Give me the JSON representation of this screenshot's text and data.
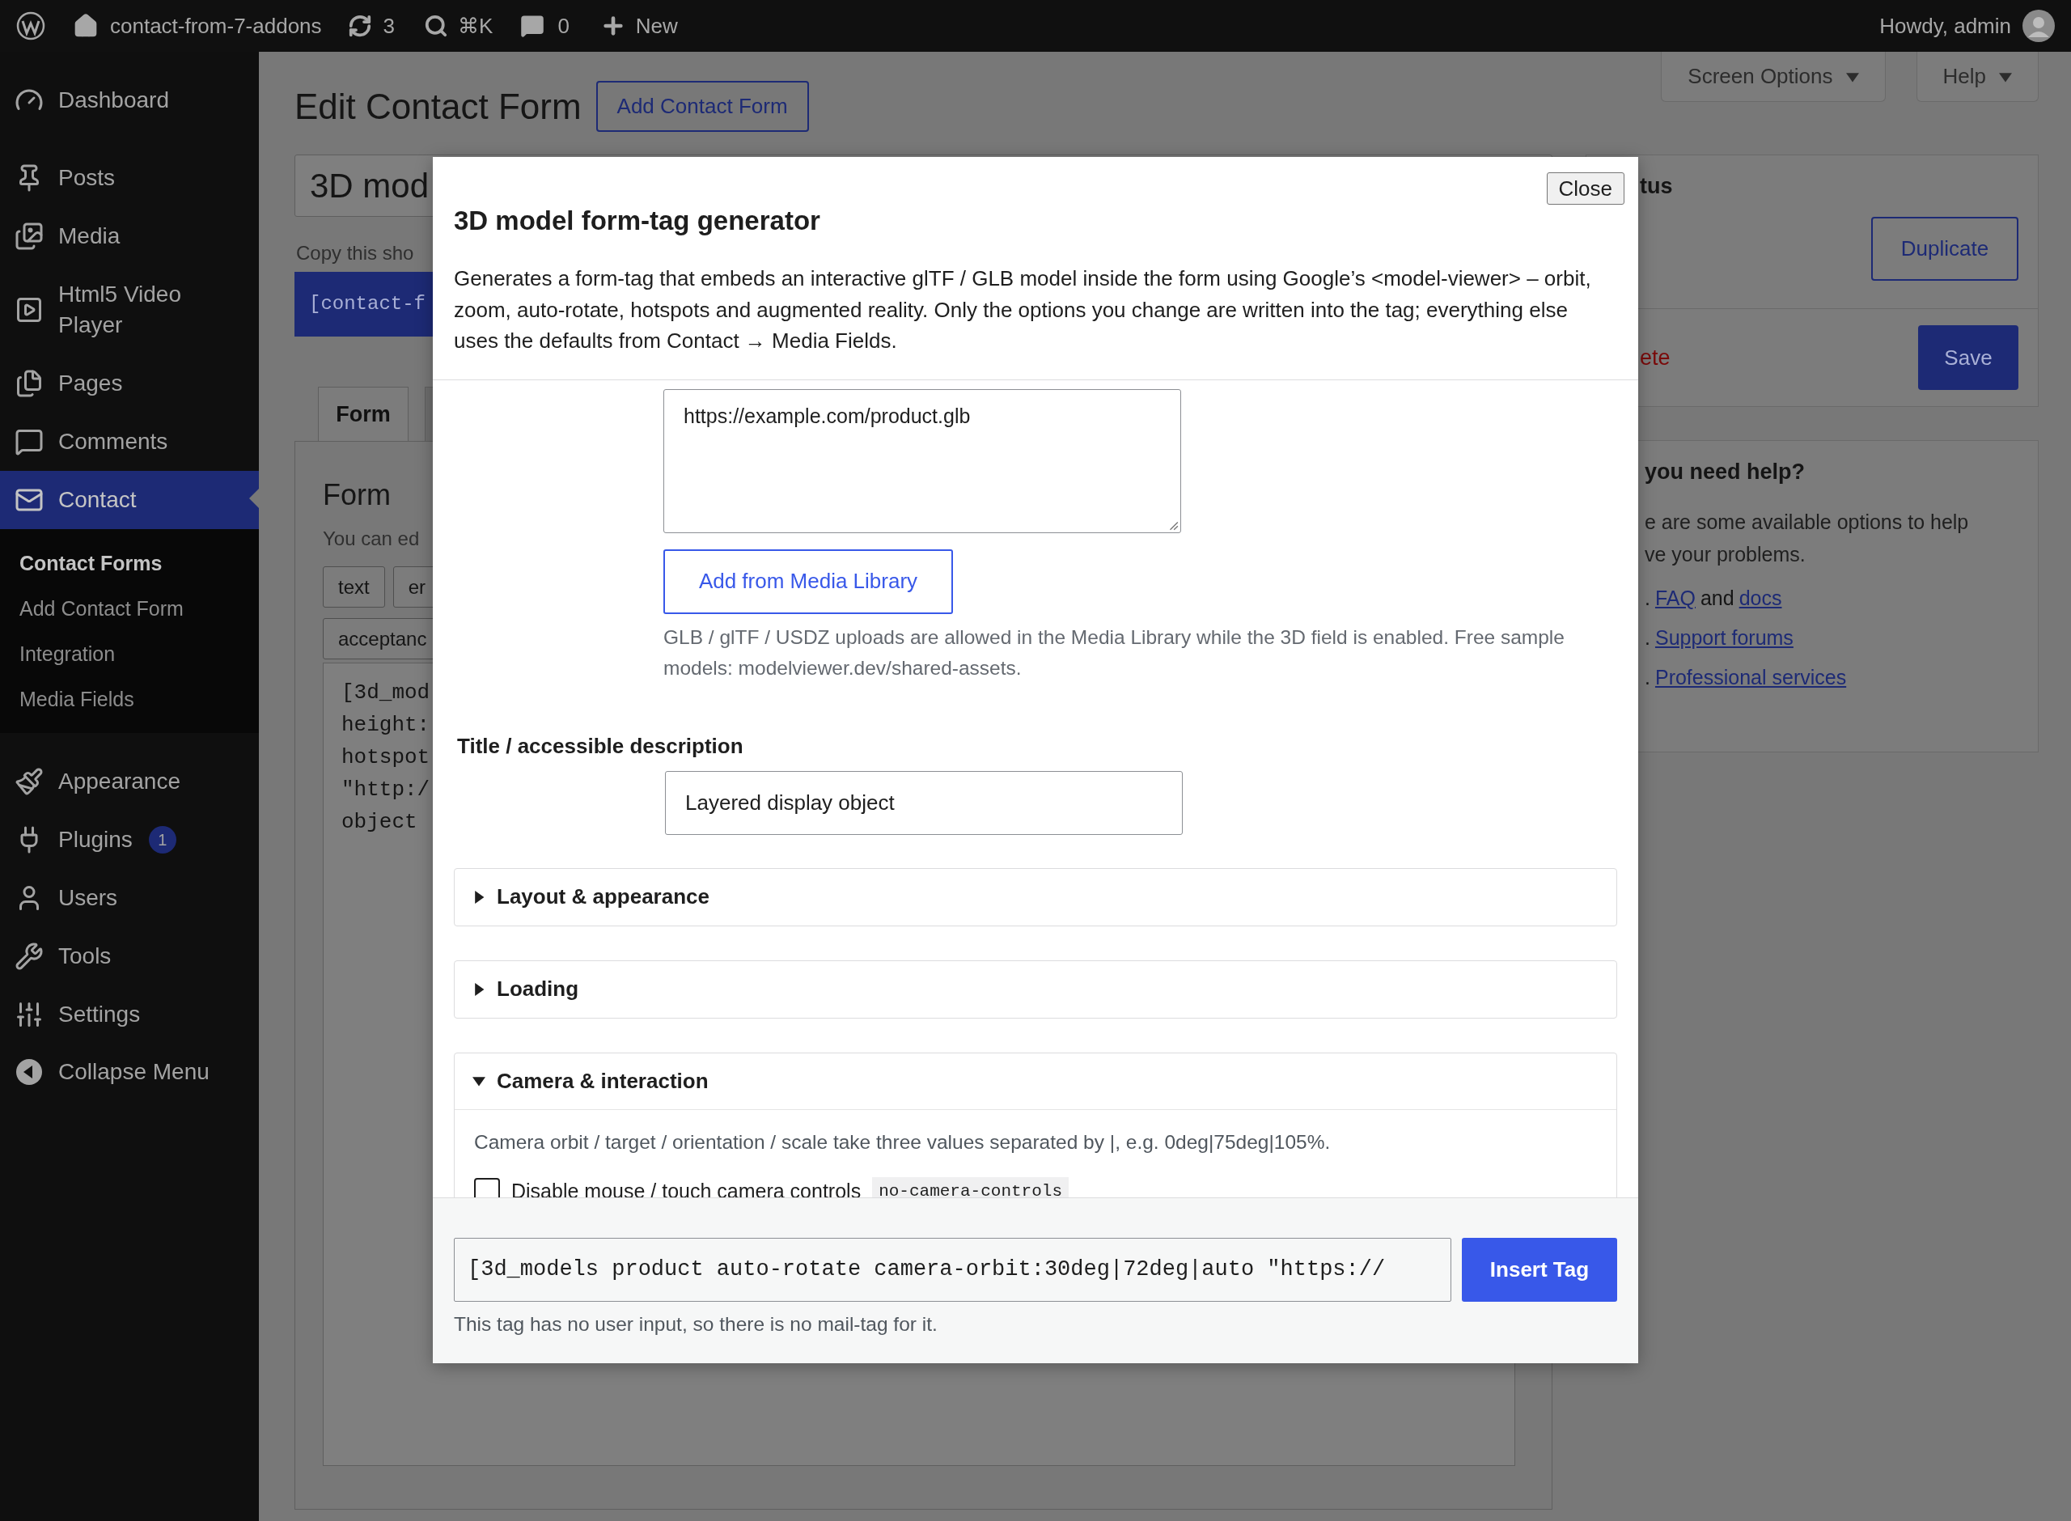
{
  "admin_bar": {
    "site": "contact-from-7-addons",
    "updates": "3",
    "search_shortcut": "⌘K",
    "comments": "0",
    "new": "New",
    "greeting": "Howdy, admin"
  },
  "sidebar": {
    "items": [
      {
        "label": "Dashboard",
        "selected": false
      },
      {
        "label": "Posts",
        "selected": false
      },
      {
        "label": "Media",
        "selected": false
      },
      {
        "label": "Html5 Video Player",
        "selected": false
      },
      {
        "label": "Pages",
        "selected": false
      },
      {
        "label": "Comments",
        "selected": false
      },
      {
        "label": "Contact",
        "selected": true,
        "children": [
          {
            "label": "Contact Forms",
            "selected": true
          },
          {
            "label": "Add Contact Form",
            "selected": false
          },
          {
            "label": "Integration",
            "selected": false
          },
          {
            "label": "Media Fields",
            "selected": false
          }
        ]
      },
      {
        "label": "Appearance",
        "selected": false
      },
      {
        "label": "Plugins",
        "selected": false,
        "badge": "1"
      },
      {
        "label": "Users",
        "selected": false
      },
      {
        "label": "Tools",
        "selected": false
      },
      {
        "label": "Settings",
        "selected": false
      }
    ],
    "collapse": "Collapse Menu"
  },
  "screen_meta": [
    "Screen Options",
    "Help"
  ],
  "page": {
    "title": "Edit Contact Form",
    "add_button": "Add Contact Form",
    "form_title": "3D mod",
    "shortcode_hint": "Copy this sho",
    "shortcode": "[contact-f",
    "tabs": [
      {
        "label": "Form",
        "selected": true
      }
    ],
    "form_panel": {
      "heading": "Form",
      "hint": "You can ed",
      "tag_button_rows": [
        [
          "text",
          "er"
        ],
        [
          "acceptanc"
        ]
      ],
      "code_lines": [
        "[3d_mod",
        "height:",
        "hotspot",
        "\"http:/",
        "object"
      ]
    }
  },
  "status_box": {
    "heading": "tus",
    "duplicate": "Duplicate",
    "delete": "ete",
    "save": "Save"
  },
  "help_box": {
    "heading": "you need help?",
    "text_lines": [
      "e are some available options to help",
      "ve your problems."
    ],
    "items": [
      {
        "marker": ".",
        "segments": [
          {
            "kind": "link",
            "text": "FAQ"
          },
          {
            "kind": "text",
            "text": "and"
          },
          {
            "kind": "link",
            "text": "docs"
          }
        ]
      },
      {
        "marker": ".",
        "segments": [
          {
            "kind": "link",
            "text": "Support forums"
          }
        ]
      },
      {
        "marker": ".",
        "segments": [
          {
            "kind": "link",
            "text": "Professional services"
          }
        ]
      }
    ]
  },
  "modal": {
    "close": "Close",
    "title": "3D model form-tag generator",
    "description": "Generates a form-tag that embeds an interactive glTF / GLB model inside the form using Google’s <model-viewer> – orbit, zoom, auto-rotate, hotspots and augmented reality. Only the options you change are written into the tag; everything else uses the defaults from Contact → Media Fields.",
    "source_value": "https://example.com/product.glb",
    "media_button": "Add from Media Library",
    "source_hint": "GLB / glTF / USDZ uploads are allowed in the Media Library while the 3D field is enabled. Free sample models: modelviewer.dev/shared-assets.",
    "title_label": "Title / accessible description",
    "title_value": "Layered display object",
    "sections": [
      {
        "title": "Layout & appearance",
        "expanded": false
      },
      {
        "title": "Loading",
        "expanded": false
      },
      {
        "title": "Camera & interaction",
        "expanded": true,
        "hint": "Camera orbit / target / orientation / scale take three values separated by |, e.g. 0deg|75deg|105%.",
        "options": [
          {
            "label": "Disable mouse / touch camera controls",
            "code": "no-camera-controls",
            "checked": false
          }
        ]
      }
    ],
    "tag_value": "[3d_models product auto-rotate camera-orbit:30deg|72deg|auto \"https://",
    "insert_button": "Insert Tag",
    "mail_note": "This tag has no user input, so there is no mail-tag for it."
  }
}
